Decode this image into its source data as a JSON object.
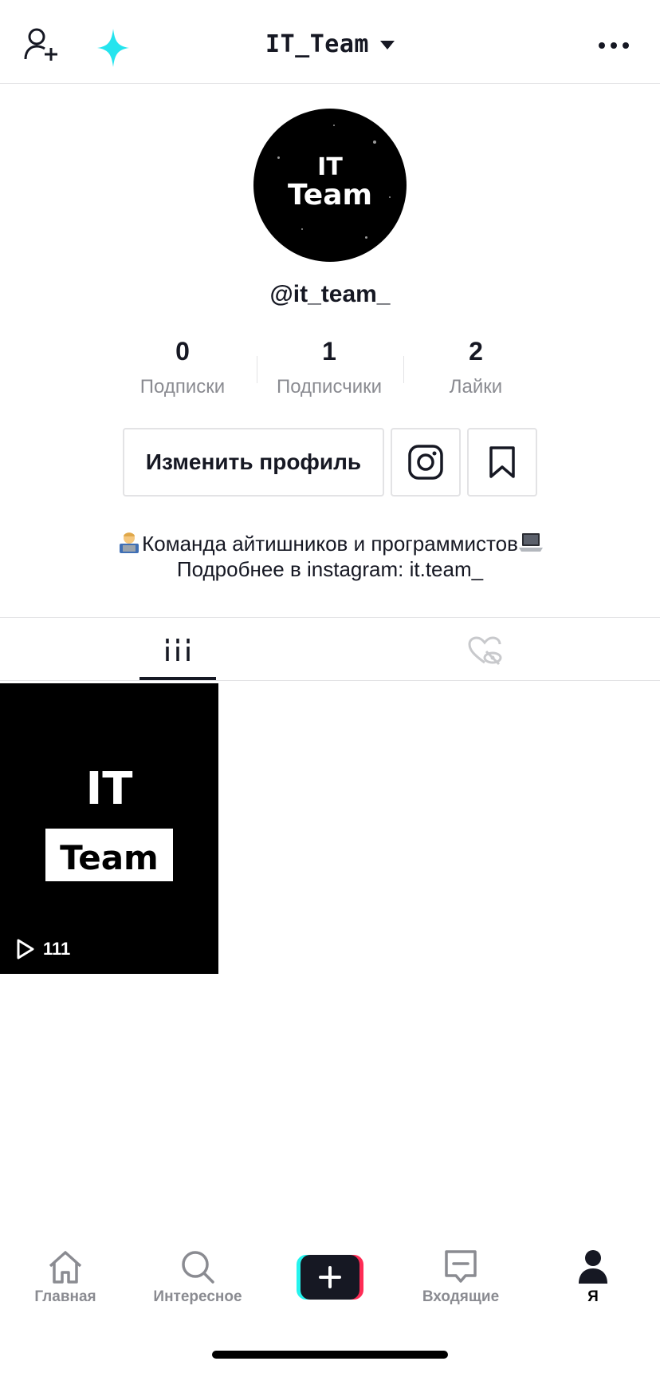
{
  "header": {
    "account_name": "IT_Team",
    "icons": {
      "add_user": "add-user-icon",
      "sparkle": "sparkle-icon",
      "more": "more-dots-icon",
      "dropdown": "caret-down-icon"
    }
  },
  "profile": {
    "avatar": {
      "line1": "IT",
      "line2": "Team"
    },
    "username": "@it_team_",
    "stats": [
      {
        "value": "0",
        "label": "Подписки"
      },
      {
        "value": "1",
        "label": "Подписчики"
      },
      {
        "value": "2",
        "label": "Лайки"
      }
    ],
    "edit_button": "Изменить профиль",
    "bio_line1_prefix_emoji": "technologist-emoji",
    "bio_line1": "Команда айтишников и программистов",
    "bio_line1_suffix_emoji": "laptop-emoji",
    "bio_line2": "Подробнее в instagram: it.team_"
  },
  "tabs": [
    {
      "icon": "grid-icon",
      "active": true
    },
    {
      "icon": "liked-hidden-icon",
      "active": false
    }
  ],
  "videos": [
    {
      "title_line1": "IT",
      "title_line2": "Team",
      "views": "111"
    }
  ],
  "bottom_nav": [
    {
      "label": "Главная",
      "icon": "home-icon",
      "active": false
    },
    {
      "label": "Интересное",
      "icon": "search-icon",
      "active": false
    },
    {
      "label": "",
      "icon": "plus-icon",
      "active": false
    },
    {
      "label": "Входящие",
      "icon": "inbox-icon",
      "active": false
    },
    {
      "label": "Я",
      "icon": "profile-icon",
      "active": true
    }
  ],
  "colors": {
    "text": "#161823",
    "secondary": "#8a8b91",
    "border": "#e3e3e5",
    "cyan": "#25f4ee",
    "pink": "#fe2c55"
  }
}
